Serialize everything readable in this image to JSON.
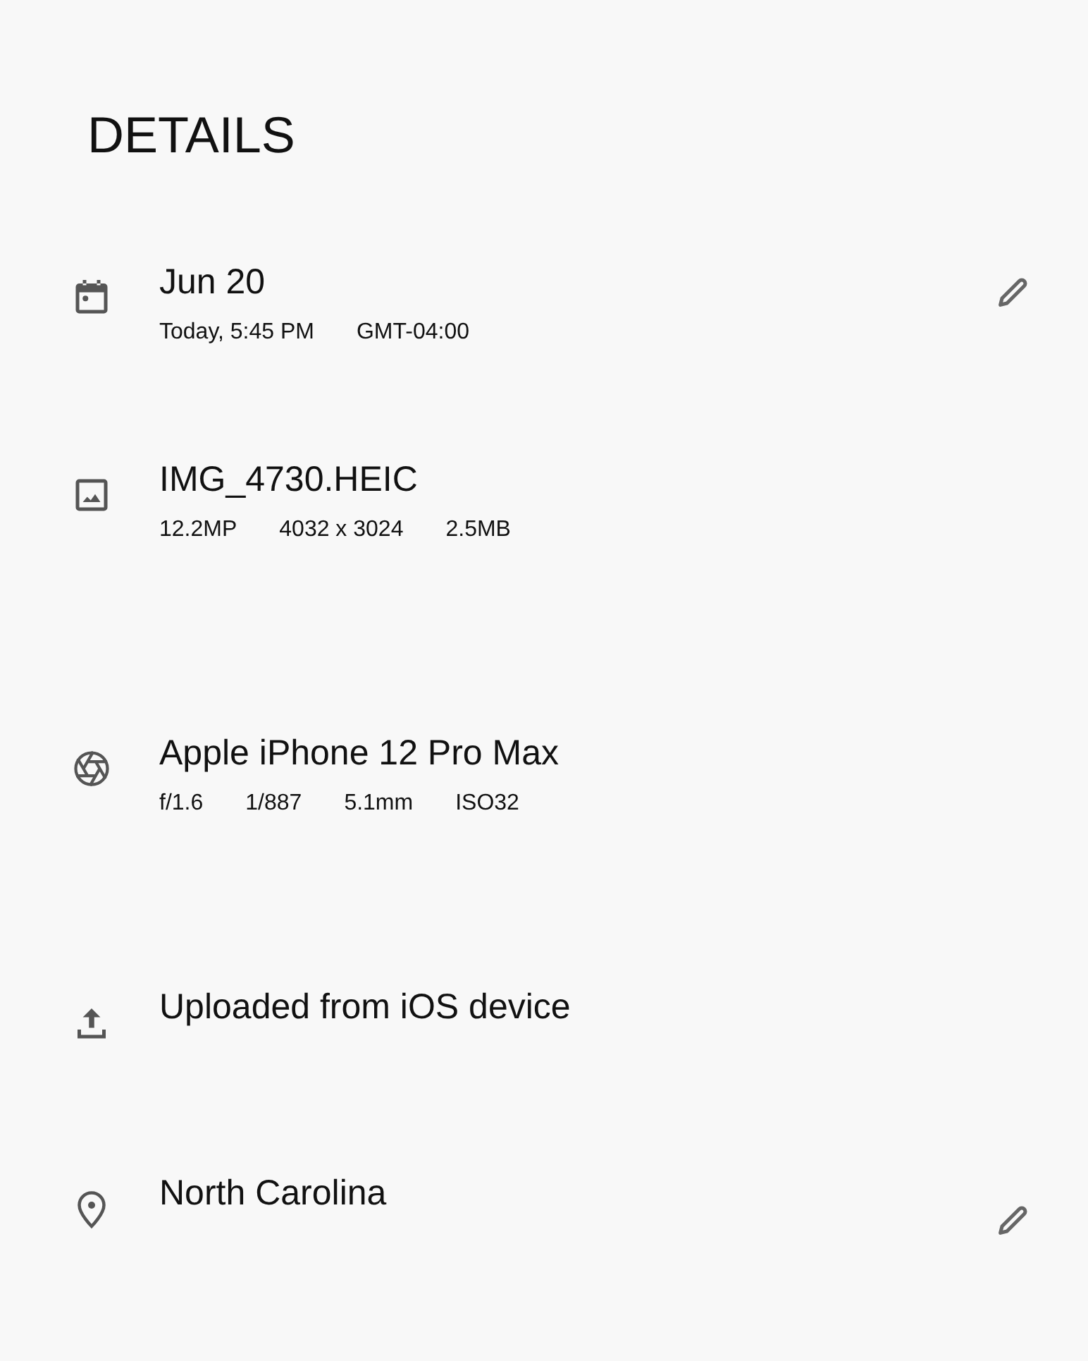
{
  "heading": "DETAILS",
  "items": [
    {
      "kind": "date",
      "title": "Jun 20",
      "details": [
        "Today, 5:45 PM",
        "GMT-04:00"
      ],
      "editable": true
    },
    {
      "kind": "image",
      "title": "IMG_4730.HEIC",
      "details": [
        "12.2MP",
        "4032 x 3024",
        "2.5MB"
      ],
      "editable": false
    },
    {
      "kind": "camera",
      "title": "Apple iPhone 12 Pro Max",
      "details": [
        "f/1.6",
        "1/887",
        "5.1mm",
        "ISO32"
      ],
      "editable": false
    },
    {
      "kind": "upload",
      "title": "Uploaded from iOS device",
      "editable": false
    },
    {
      "kind": "location",
      "title": "North Carolina",
      "editable": true
    }
  ]
}
